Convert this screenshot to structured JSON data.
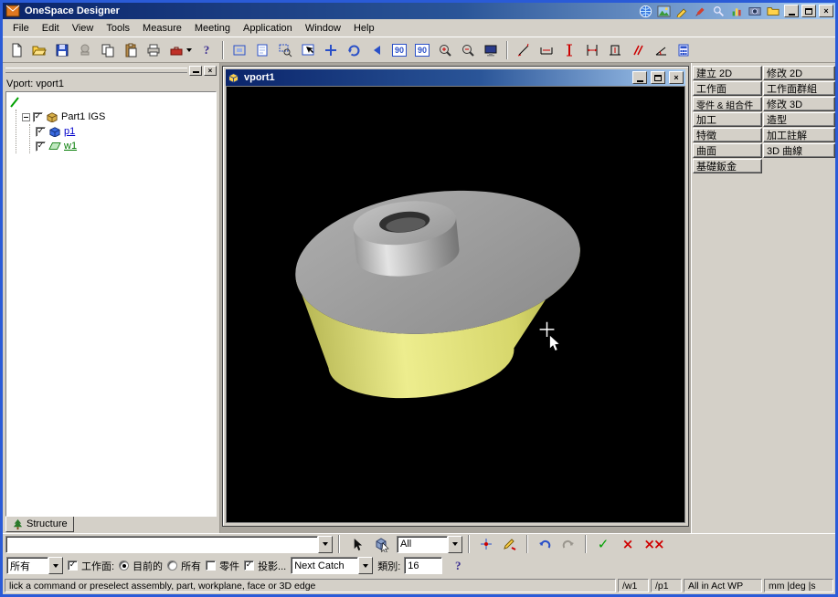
{
  "icons": {
    "check": "✓",
    "close": "×",
    "cross": "×",
    "double_cross": "××",
    "question": "?"
  },
  "window": {
    "title": "OneSpace Designer"
  },
  "menubar": {
    "items": [
      "File",
      "Edit",
      "View",
      "Tools",
      "Measure",
      "Meeting",
      "Application",
      "Window",
      "Help"
    ]
  },
  "toolbar": {
    "rot90": "90"
  },
  "left_panel": {
    "header": "Vport: vport1",
    "items": [
      {
        "label": "Part1 IGS"
      },
      {
        "label": "p1"
      },
      {
        "label": "w1"
      }
    ],
    "tab_label": "Structure"
  },
  "viewport": {
    "title": "vport1"
  },
  "right_panel": {
    "buttons": [
      "建立 2D",
      "修改 2D",
      "工作面",
      "工作面群組",
      "零件 & 組合件",
      "修改 3D",
      "加工",
      "造型",
      "特徵",
      "加工註解",
      "曲面",
      "3D 曲線",
      "基礎鈑金"
    ]
  },
  "command_bar": {
    "command_value": "",
    "scope_value": "All"
  },
  "options_bar": {
    "filter_value": "所有",
    "workplane_label": "工作面:",
    "current_label": "目前的",
    "all_label": "所有",
    "part_label": "零件",
    "projection_label": "投影...",
    "catch_value": "Next Catch",
    "category_label": "類別:",
    "category_value": "16"
  },
  "status_bar": {
    "message": "lick a command or preselect assembly, part, workplane, face or 3D edge",
    "wp": "/w1",
    "part": "/p1",
    "act": "All in Act WP",
    "units": "mm |deg |s"
  }
}
